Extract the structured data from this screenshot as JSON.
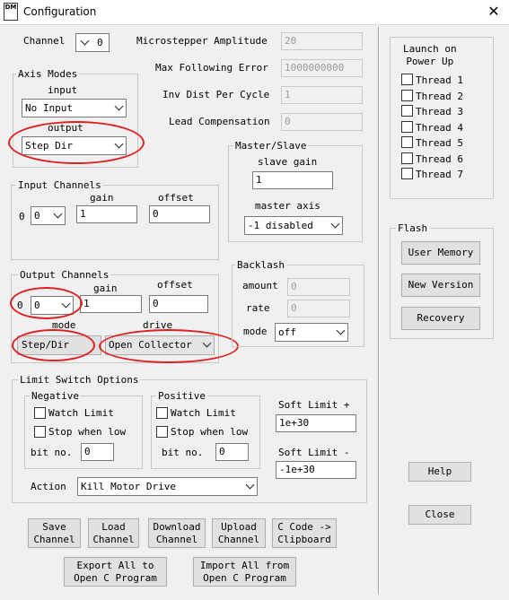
{
  "window": {
    "title": "Configuration",
    "icon_label": "DM",
    "close_symbol": "✕"
  },
  "channel": {
    "label": "Channel",
    "value": "0"
  },
  "params": {
    "microstepper_amplitude": {
      "label": "Microstepper Amplitude",
      "value": "20"
    },
    "max_following_error": {
      "label": "Max Following Error",
      "value": "1000000000"
    },
    "inv_dist_per_cycle": {
      "label": "Inv Dist Per Cycle",
      "value": "1"
    },
    "lead_compensation": {
      "label": "Lead Compensation",
      "value": "0"
    }
  },
  "axis_modes": {
    "title": "Axis Modes",
    "input_label": "input",
    "input_value": "No Input",
    "output_label": "output",
    "output_value": "Step Dir"
  },
  "input_channels": {
    "title": "Input Channels",
    "gain_label": "gain",
    "offset_label": "offset",
    "row_label": "0",
    "channel_value": "0",
    "gain_value": "1",
    "offset_value": "0"
  },
  "output_channels": {
    "title": "Output Channels",
    "gain_label": "gain",
    "offset_label": "offset",
    "row_label": "0",
    "channel_value": "0",
    "gain_value": "1",
    "offset_value": "0",
    "mode_label": "mode",
    "mode_value": "Step/Dir",
    "drive_label": "drive",
    "drive_value": "Open Collector"
  },
  "master_slave": {
    "title": "Master/Slave",
    "slave_gain_label": "slave gain",
    "slave_gain_value": "1",
    "master_axis_label": "master axis",
    "master_axis_value": "-1 disabled"
  },
  "backlash": {
    "title": "Backlash",
    "amount_label": "amount",
    "amount_value": "0",
    "rate_label": "rate",
    "rate_value": "0",
    "mode_label": "mode",
    "mode_value": "off"
  },
  "limit_switch": {
    "title": "Limit Switch Options",
    "negative": {
      "title": "Negative",
      "watch_limit": "Watch Limit",
      "stop_when_low": "Stop when low",
      "bit_no_label": "bit no.",
      "bit_no_value": "0"
    },
    "positive": {
      "title": "Positive",
      "watch_limit": "Watch Limit",
      "stop_when_low": "Stop when low",
      "bit_no_label": "bit no.",
      "bit_no_value": "0"
    },
    "soft_limit_plus_label": "Soft Limit +",
    "soft_limit_plus_value": "1e+30",
    "soft_limit_minus_label": "Soft Limit -",
    "soft_limit_minus_value": "-1e+30",
    "action_label": "Action",
    "action_value": "Kill Motor Drive"
  },
  "bottom_buttons": {
    "save": "Save\nChannel",
    "load": "Load\nChannel",
    "download": "Download\nChannel",
    "upload": "Upload\nChannel",
    "c_code": "C Code ->\nClipboard",
    "export_all": "Export All to\nOpen C Program",
    "import_all": "Import All from\nOpen C Program"
  },
  "launch_on_power_up": {
    "title": "Launch on\nPower Up",
    "threads": [
      "Thread 1",
      "Thread 2",
      "Thread 3",
      "Thread 4",
      "Thread 5",
      "Thread 6",
      "Thread 7"
    ]
  },
  "flash": {
    "title": "Flash",
    "user_memory": "User Memory",
    "new_version": "New Version",
    "recovery": "Recovery"
  },
  "help": "Help",
  "close": "Close",
  "colors": {
    "annotation_red": "#e02020",
    "window_bg": "#f0f0f0",
    "button_bg": "#e1e1e1"
  }
}
